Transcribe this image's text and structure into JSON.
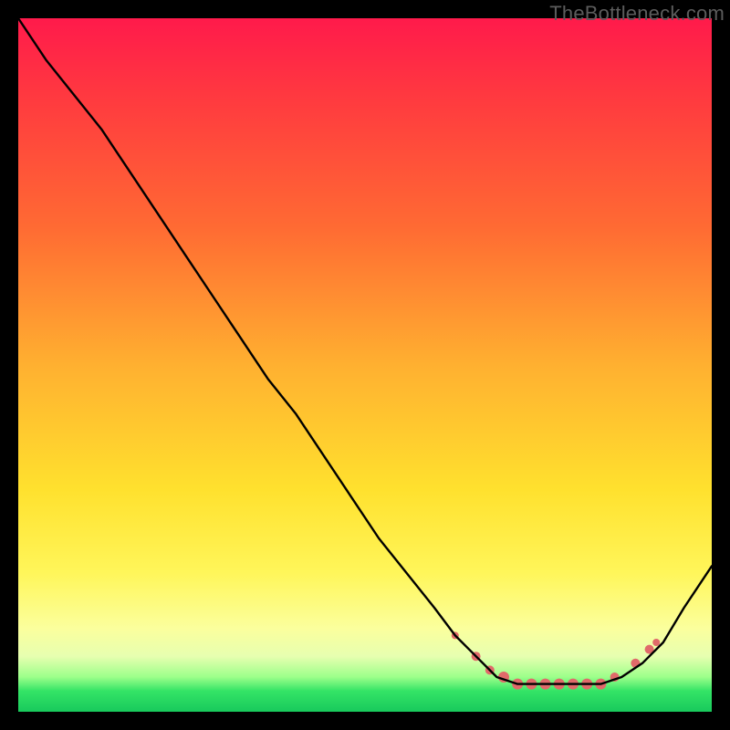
{
  "watermark": "TheBottleneck.com",
  "chart_data": {
    "type": "line",
    "title": "",
    "xlabel": "",
    "ylabel": "",
    "xlim": [
      0,
      100
    ],
    "ylim": [
      0,
      100
    ],
    "series": [
      {
        "name": "bottleneck-curve",
        "x": [
          0,
          4,
          8,
          12,
          16,
          20,
          24,
          28,
          32,
          36,
          40,
          44,
          48,
          52,
          56,
          60,
          63,
          66,
          69,
          72,
          75,
          78,
          81,
          84,
          87,
          90,
          93,
          96,
          100
        ],
        "y": [
          100,
          94,
          89,
          84,
          78,
          72,
          66,
          60,
          54,
          48,
          43,
          37,
          31,
          25,
          20,
          15,
          11,
          8,
          5,
          4,
          4,
          4,
          4,
          4,
          5,
          7,
          10,
          15,
          21
        ]
      }
    ],
    "markers": {
      "name": "valley-markers",
      "color": "#e06a6a",
      "points": [
        {
          "x": 63,
          "y": 11,
          "r": 4
        },
        {
          "x": 66,
          "y": 8,
          "r": 5
        },
        {
          "x": 68,
          "y": 6,
          "r": 5
        },
        {
          "x": 70,
          "y": 5,
          "r": 6
        },
        {
          "x": 72,
          "y": 4,
          "r": 6
        },
        {
          "x": 74,
          "y": 4,
          "r": 6
        },
        {
          "x": 76,
          "y": 4,
          "r": 6
        },
        {
          "x": 78,
          "y": 4,
          "r": 6
        },
        {
          "x": 80,
          "y": 4,
          "r": 6
        },
        {
          "x": 82,
          "y": 4,
          "r": 6
        },
        {
          "x": 84,
          "y": 4,
          "r": 6
        },
        {
          "x": 86,
          "y": 5,
          "r": 5
        },
        {
          "x": 89,
          "y": 7,
          "r": 5
        },
        {
          "x": 91,
          "y": 9,
          "r": 5
        },
        {
          "x": 92,
          "y": 10,
          "r": 4
        }
      ]
    }
  }
}
